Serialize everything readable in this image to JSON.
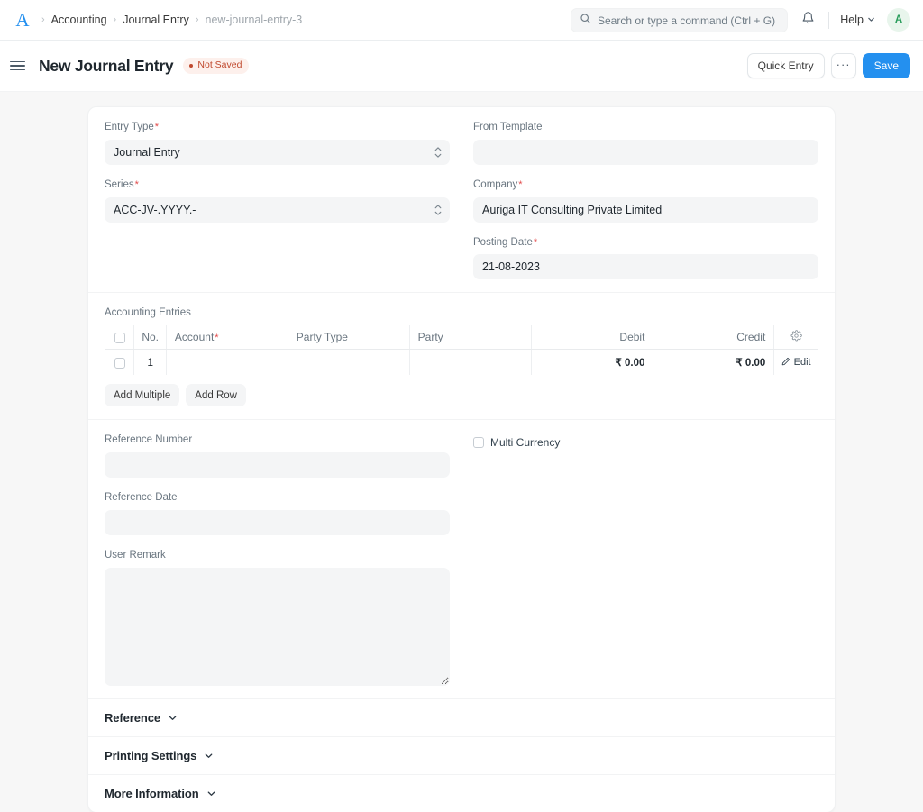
{
  "navbar": {
    "logo": "A",
    "breadcrumb": [
      {
        "label": "Accounting",
        "current": false
      },
      {
        "label": "Journal Entry",
        "current": false
      },
      {
        "label": "new-journal-entry-3",
        "current": true
      }
    ],
    "search": {
      "placeholder": "Search or type a command (Ctrl + G)",
      "value": "",
      "icon": "search-icon"
    },
    "notifications_icon": "bell-icon",
    "help_label": "Help",
    "help_chevron_icon": "chevron-down-icon",
    "avatar_initial": "A"
  },
  "page_head": {
    "menu_icon": "hamburger-icon",
    "title": "New Journal Entry",
    "status_badge": "Not Saved",
    "quick_entry_label": "Quick Entry",
    "more_label": "···",
    "save_label": "Save"
  },
  "form": {
    "entry_type": {
      "label": "Entry Type",
      "required": true,
      "value": "Journal Entry"
    },
    "from_template": {
      "label": "From Template",
      "required": false,
      "value": ""
    },
    "series": {
      "label": "Series",
      "required": true,
      "value": "ACC-JV-.YYYY.-"
    },
    "company": {
      "label": "Company",
      "required": true,
      "value": "Auriga IT Consulting Private Limited"
    },
    "posting_date": {
      "label": "Posting Date",
      "required": true,
      "value": "21-08-2023"
    },
    "reference_number": {
      "label": "Reference Number",
      "required": false,
      "value": ""
    },
    "reference_date": {
      "label": "Reference Date",
      "required": false,
      "value": ""
    },
    "user_remark": {
      "label": "User Remark",
      "required": false,
      "value": ""
    },
    "multi_currency": {
      "label": "Multi Currency",
      "checked": false
    }
  },
  "entries_grid": {
    "label": "Accounting Entries",
    "settings_icon": "gear-icon",
    "columns": [
      {
        "key": "checkbox",
        "label": ""
      },
      {
        "key": "no",
        "label": "No."
      },
      {
        "key": "account",
        "label": "Account",
        "required": true
      },
      {
        "key": "party_type",
        "label": "Party Type",
        "required": false
      },
      {
        "key": "party",
        "label": "Party",
        "required": false
      },
      {
        "key": "debit",
        "label": "Debit",
        "required": false
      },
      {
        "key": "credit",
        "label": "Credit",
        "required": false
      }
    ],
    "rows": [
      {
        "no": "1",
        "account": "",
        "party_type": "",
        "party": "",
        "debit": "₹ 0.00",
        "credit": "₹ 0.00",
        "edit_label": "Edit",
        "edit_icon": "pencil-icon"
      }
    ],
    "add_multiple_label": "Add Multiple",
    "add_row_label": "Add Row"
  },
  "collapsible_sections": [
    {
      "title": "Reference",
      "expanded": false,
      "icon": "chevron-down-icon"
    },
    {
      "title": "Printing Settings",
      "expanded": false,
      "icon": "chevron-down-icon"
    },
    {
      "title": "More Information",
      "expanded": false,
      "icon": "chevron-down-icon"
    }
  ],
  "colors": {
    "primary": "#2490EF",
    "page_bg": "#F7F7F7",
    "card_bg": "#FFFFFF",
    "control_bg": "#F4F5F6",
    "required_red": "#E24C4C",
    "badge_bg": "#FDF0EC",
    "badge_text": "#C0492E",
    "avatar_bg": "#E8F5EC",
    "avatar_text": "#2A9D5C"
  }
}
